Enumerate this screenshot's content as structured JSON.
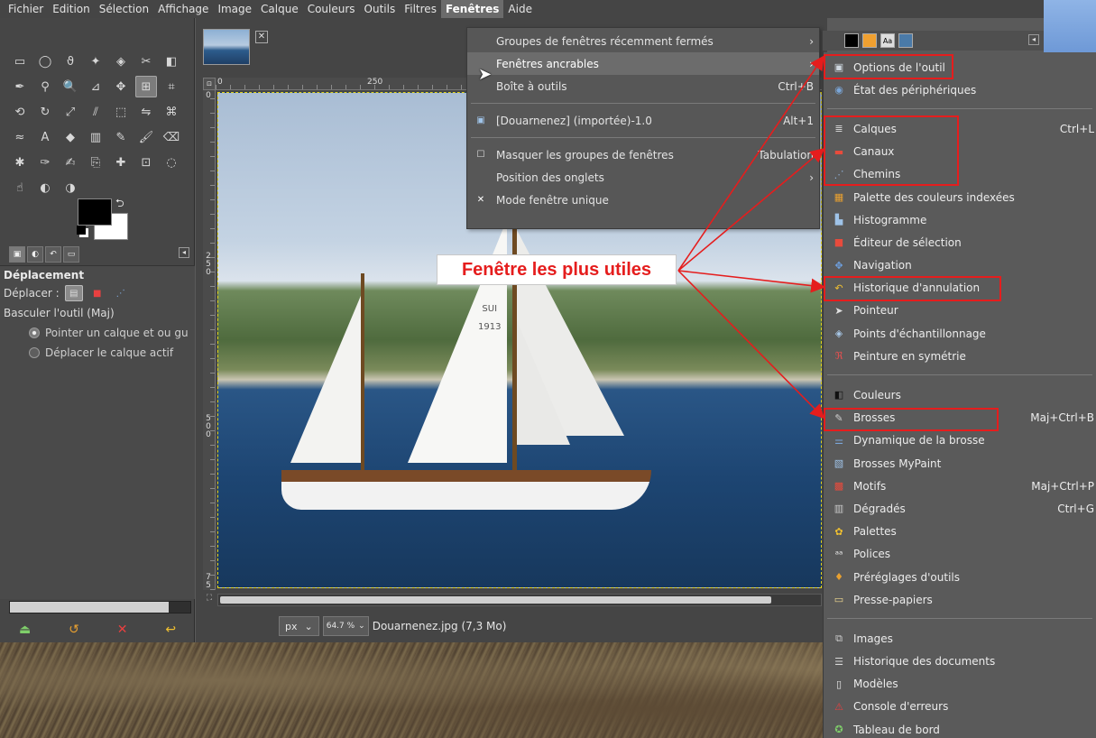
{
  "menubar": {
    "items": [
      "Fichier",
      "Edition",
      "Sélection",
      "Affichage",
      "Image",
      "Calque",
      "Couleurs",
      "Outils",
      "Filtres",
      "Fenêtres",
      "Aide"
    ],
    "active_index": 9
  },
  "toolbox": {
    "tool_icons": [
      "rect-select-icon",
      "ellipse-select-icon",
      "lasso-icon",
      "fuzzy-select-icon",
      "color-select-icon",
      "scissors-icon",
      "foreground-select-icon",
      "paths-icon",
      "color-picker-icon",
      "zoom-icon",
      "measure-icon",
      "move-icon",
      "align-icon",
      "crop-icon",
      "unified-transform-icon",
      "rotate-icon",
      "scale-icon",
      "shear-icon",
      "perspective-icon",
      "flip-icon",
      "cage-icon",
      "warp-icon",
      "text-icon",
      "bucket-fill-icon",
      "gradient-icon",
      "pencil-icon",
      "paintbrush-icon",
      "eraser-icon",
      "airbrush-icon",
      "ink-icon",
      "mypaint-icon",
      "clone-icon",
      "heal-icon",
      "perspective-clone-icon",
      "blur-icon",
      "smudge-icon",
      "dodge-icon",
      "burn-icon"
    ],
    "selected_tool_index": 12
  },
  "tool_options": {
    "title": "Déplacement",
    "move_label": "Déplacer :",
    "toggle_label": "Basculer l'outil  (Maj)",
    "radio_1": "Pointer un calque et ou gu",
    "radio_2": "Déplacer le calque actif"
  },
  "toolbox_progress": 0.88,
  "image_window": {
    "ruler_corner": "⊡",
    "ruler_h_labels": [
      "0",
      "250"
    ],
    "ruler_v_labels": [
      "0",
      "2\n5\n0",
      "5\n0\n0",
      "7\n5"
    ],
    "sail_text": "SUI\n1913",
    "unit": "px",
    "zoom": "64.7 %",
    "file_info": "Douarnenez.jpg (7,3 Mo)"
  },
  "canvas_scroll_fraction": 0.92,
  "windows_menu": {
    "items": [
      {
        "label": "Groupes de fenêtres récemment fermés",
        "shortcut": "",
        "arrow": "›",
        "style": "normal"
      },
      {
        "label": "Fenêtres ancrables",
        "shortcut": "",
        "arrow": "›",
        "style": "hover"
      },
      {
        "label": "Boîte à outils",
        "shortcut": "Ctrl+B",
        "arrow": "",
        "style": "normal"
      },
      {
        "label": "[Douarnenez] (importée)-1.0",
        "shortcut": "Alt+1",
        "arrow": "",
        "style": "normal"
      },
      {
        "label": "Masquer les groupes de fenêtres",
        "shortcut": "Tabulation",
        "arrow": "",
        "style": "normal"
      },
      {
        "label": "Position des onglets",
        "shortcut": "",
        "arrow": "›",
        "style": "normal"
      },
      {
        "label": "Mode fenêtre unique",
        "shortcut": "",
        "arrow": "",
        "style": "normal"
      }
    ]
  },
  "dock_head": {
    "swatch_text": "Aa"
  },
  "submenu": {
    "group_1": [
      {
        "label": "Options de l'outil",
        "shortcut": "",
        "icon": "tool-options-icon"
      },
      {
        "label": "État des périphériques",
        "shortcut": "",
        "icon": "device-status-icon"
      }
    ],
    "group_2": [
      {
        "label": "Calques",
        "shortcut": "Ctrl+L",
        "icon": "layers-icon"
      },
      {
        "label": "Canaux",
        "shortcut": "",
        "icon": "channels-icon"
      },
      {
        "label": "Chemins",
        "shortcut": "",
        "icon": "paths-icon"
      },
      {
        "label": "Palette des couleurs indexées",
        "shortcut": "",
        "icon": "colormap-icon"
      },
      {
        "label": "Histogramme",
        "shortcut": "",
        "icon": "histogram-icon"
      },
      {
        "label": "Éditeur de sélection",
        "shortcut": "",
        "icon": "selection-editor-icon"
      },
      {
        "label": "Navigation",
        "shortcut": "",
        "icon": "navigation-icon"
      },
      {
        "label": "Historique d'annulation",
        "shortcut": "",
        "icon": "undo-history-icon"
      },
      {
        "label": "Pointeur",
        "shortcut": "",
        "icon": "pointer-icon"
      },
      {
        "label": "Points d'échantillonnage",
        "shortcut": "",
        "icon": "sample-points-icon"
      },
      {
        "label": "Peinture en symétrie",
        "shortcut": "",
        "icon": "symmetry-icon"
      }
    ],
    "group_3": [
      {
        "label": "Couleurs",
        "shortcut": "",
        "icon": "colors-icon"
      },
      {
        "label": "Brosses",
        "shortcut": "Maj+Ctrl+B",
        "icon": "brushes-icon"
      },
      {
        "label": "Dynamique de la brosse",
        "shortcut": "",
        "icon": "brush-dynamics-icon"
      },
      {
        "label": "Brosses MyPaint",
        "shortcut": "",
        "icon": "mypaint-brushes-icon"
      },
      {
        "label": "Motifs",
        "shortcut": "Maj+Ctrl+P",
        "icon": "patterns-icon"
      },
      {
        "label": "Dégradés",
        "shortcut": "Ctrl+G",
        "icon": "gradients-icon"
      },
      {
        "label": "Palettes",
        "shortcut": "",
        "icon": "palettes-icon"
      },
      {
        "label": "Polices",
        "shortcut": "",
        "icon": "fonts-icon"
      },
      {
        "label": "Préréglages d'outils",
        "shortcut": "",
        "icon": "tool-presets-icon"
      },
      {
        "label": "Presse-papiers",
        "shortcut": "",
        "icon": "clipboard-icon"
      }
    ],
    "group_4": [
      {
        "label": "Images",
        "shortcut": "",
        "icon": "images-icon"
      },
      {
        "label": "Historique des documents",
        "shortcut": "",
        "icon": "document-history-icon"
      },
      {
        "label": "Modèles",
        "shortcut": "",
        "icon": "templates-icon"
      },
      {
        "label": "Console d'erreurs",
        "shortcut": "",
        "icon": "error-console-icon"
      },
      {
        "label": "Tableau de bord",
        "shortcut": "",
        "icon": "dashboard-icon"
      }
    ]
  },
  "annotation": {
    "callout_text": "Fenêtre les plus utiles",
    "color": "#e51d1d"
  }
}
